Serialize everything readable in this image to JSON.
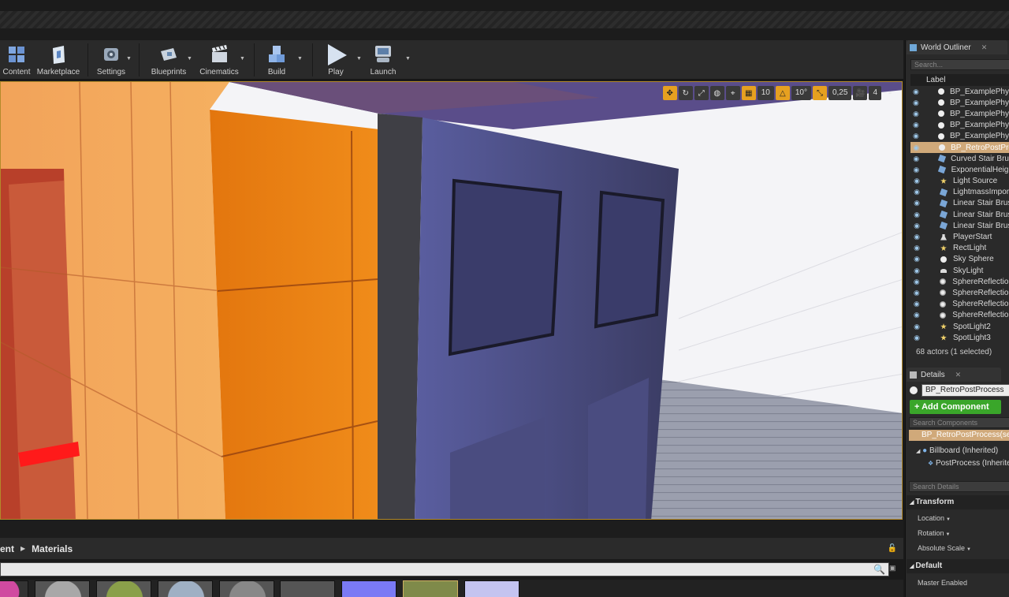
{
  "toolbar": {
    "buttons": [
      {
        "label": "Content",
        "icon": "content-browser-icon"
      },
      {
        "label": "Marketplace",
        "icon": "marketplace-icon"
      },
      {
        "label": "Settings",
        "icon": "settings-icon"
      },
      {
        "label": "Blueprints",
        "icon": "blueprints-icon"
      },
      {
        "label": "Cinematics",
        "icon": "cinematics-icon"
      },
      {
        "label": "Build",
        "icon": "build-icon"
      },
      {
        "label": "Play",
        "icon": "play-icon"
      },
      {
        "label": "Launch",
        "icon": "launch-icon"
      }
    ]
  },
  "viewport": {
    "grid_snap": "10",
    "rotation_snap": "10°",
    "scale_snap": "0,25",
    "camera_speed": "4",
    "accent": "#b38a2a"
  },
  "world_outliner": {
    "title": "World Outliner",
    "search_placeholder": "Search...",
    "column_label": "Label",
    "actors": [
      {
        "name": "BP_ExamplePhys",
        "icon": "sphere-actor-icon",
        "selected": false
      },
      {
        "name": "BP_ExamplePhys",
        "icon": "sphere-actor-icon",
        "selected": false
      },
      {
        "name": "BP_ExamplePhys",
        "icon": "sphere-actor-icon",
        "selected": false
      },
      {
        "name": "BP_ExamplePhys",
        "icon": "sphere-actor-icon",
        "selected": false
      },
      {
        "name": "BP_ExamplePhys",
        "icon": "sphere-actor-icon",
        "selected": false
      },
      {
        "name": "BP_RetroPostPro",
        "icon": "sphere-actor-icon",
        "selected": true
      },
      {
        "name": "Curved Stair Brus",
        "icon": "brush-icon",
        "selected": false
      },
      {
        "name": "ExponentialHeigh",
        "icon": "brush-icon",
        "selected": false
      },
      {
        "name": "Light Source",
        "icon": "light-icon",
        "selected": false
      },
      {
        "name": "LightmassImport",
        "icon": "brush-icon",
        "selected": false
      },
      {
        "name": "Linear Stair Brus",
        "icon": "brush-icon",
        "selected": false
      },
      {
        "name": "Linear Stair Brus",
        "icon": "brush-icon",
        "selected": false
      },
      {
        "name": "Linear Stair Brus",
        "icon": "brush-icon",
        "selected": false
      },
      {
        "name": "PlayerStart",
        "icon": "player-start-icon",
        "selected": false
      },
      {
        "name": "RectLight",
        "icon": "light-icon",
        "selected": false
      },
      {
        "name": "Sky Sphere",
        "icon": "sphere-actor-icon",
        "selected": false
      },
      {
        "name": "SkyLight",
        "icon": "skylight-icon",
        "selected": false
      },
      {
        "name": "SphereReflection",
        "icon": "reflection-icon",
        "selected": false
      },
      {
        "name": "SphereReflection",
        "icon": "reflection-icon",
        "selected": false
      },
      {
        "name": "SphereReflection",
        "icon": "reflection-icon",
        "selected": false
      },
      {
        "name": "SphereReflection",
        "icon": "reflection-icon",
        "selected": false
      },
      {
        "name": "SpotLight2",
        "icon": "light-icon",
        "selected": false
      },
      {
        "name": "SpotLight3",
        "icon": "light-icon",
        "selected": false
      }
    ],
    "actor_count": "68 actors (1 selected)"
  },
  "details": {
    "title": "Details",
    "actor_name": "BP_RetroPostProcess",
    "add_component": "+ Add Component",
    "search_components_placeholder": "Search Components",
    "components": [
      {
        "label": "BP_RetroPostProcess(self)",
        "selected": true
      },
      {
        "label": "Billboard (Inherited)",
        "selected": false
      },
      {
        "label": "PostProcess (Inherite",
        "selected": false
      }
    ],
    "search_details_placeholder": "Search Details",
    "sections": {
      "transform": "Transform",
      "default": "Default"
    },
    "properties": {
      "location": "Location",
      "rotation": "Rotation",
      "absolute_scale": "Absolute Scale",
      "master_enabled": "Master Enabled"
    }
  },
  "content_browser": {
    "breadcrumb": [
      "ent",
      "Materials"
    ]
  }
}
